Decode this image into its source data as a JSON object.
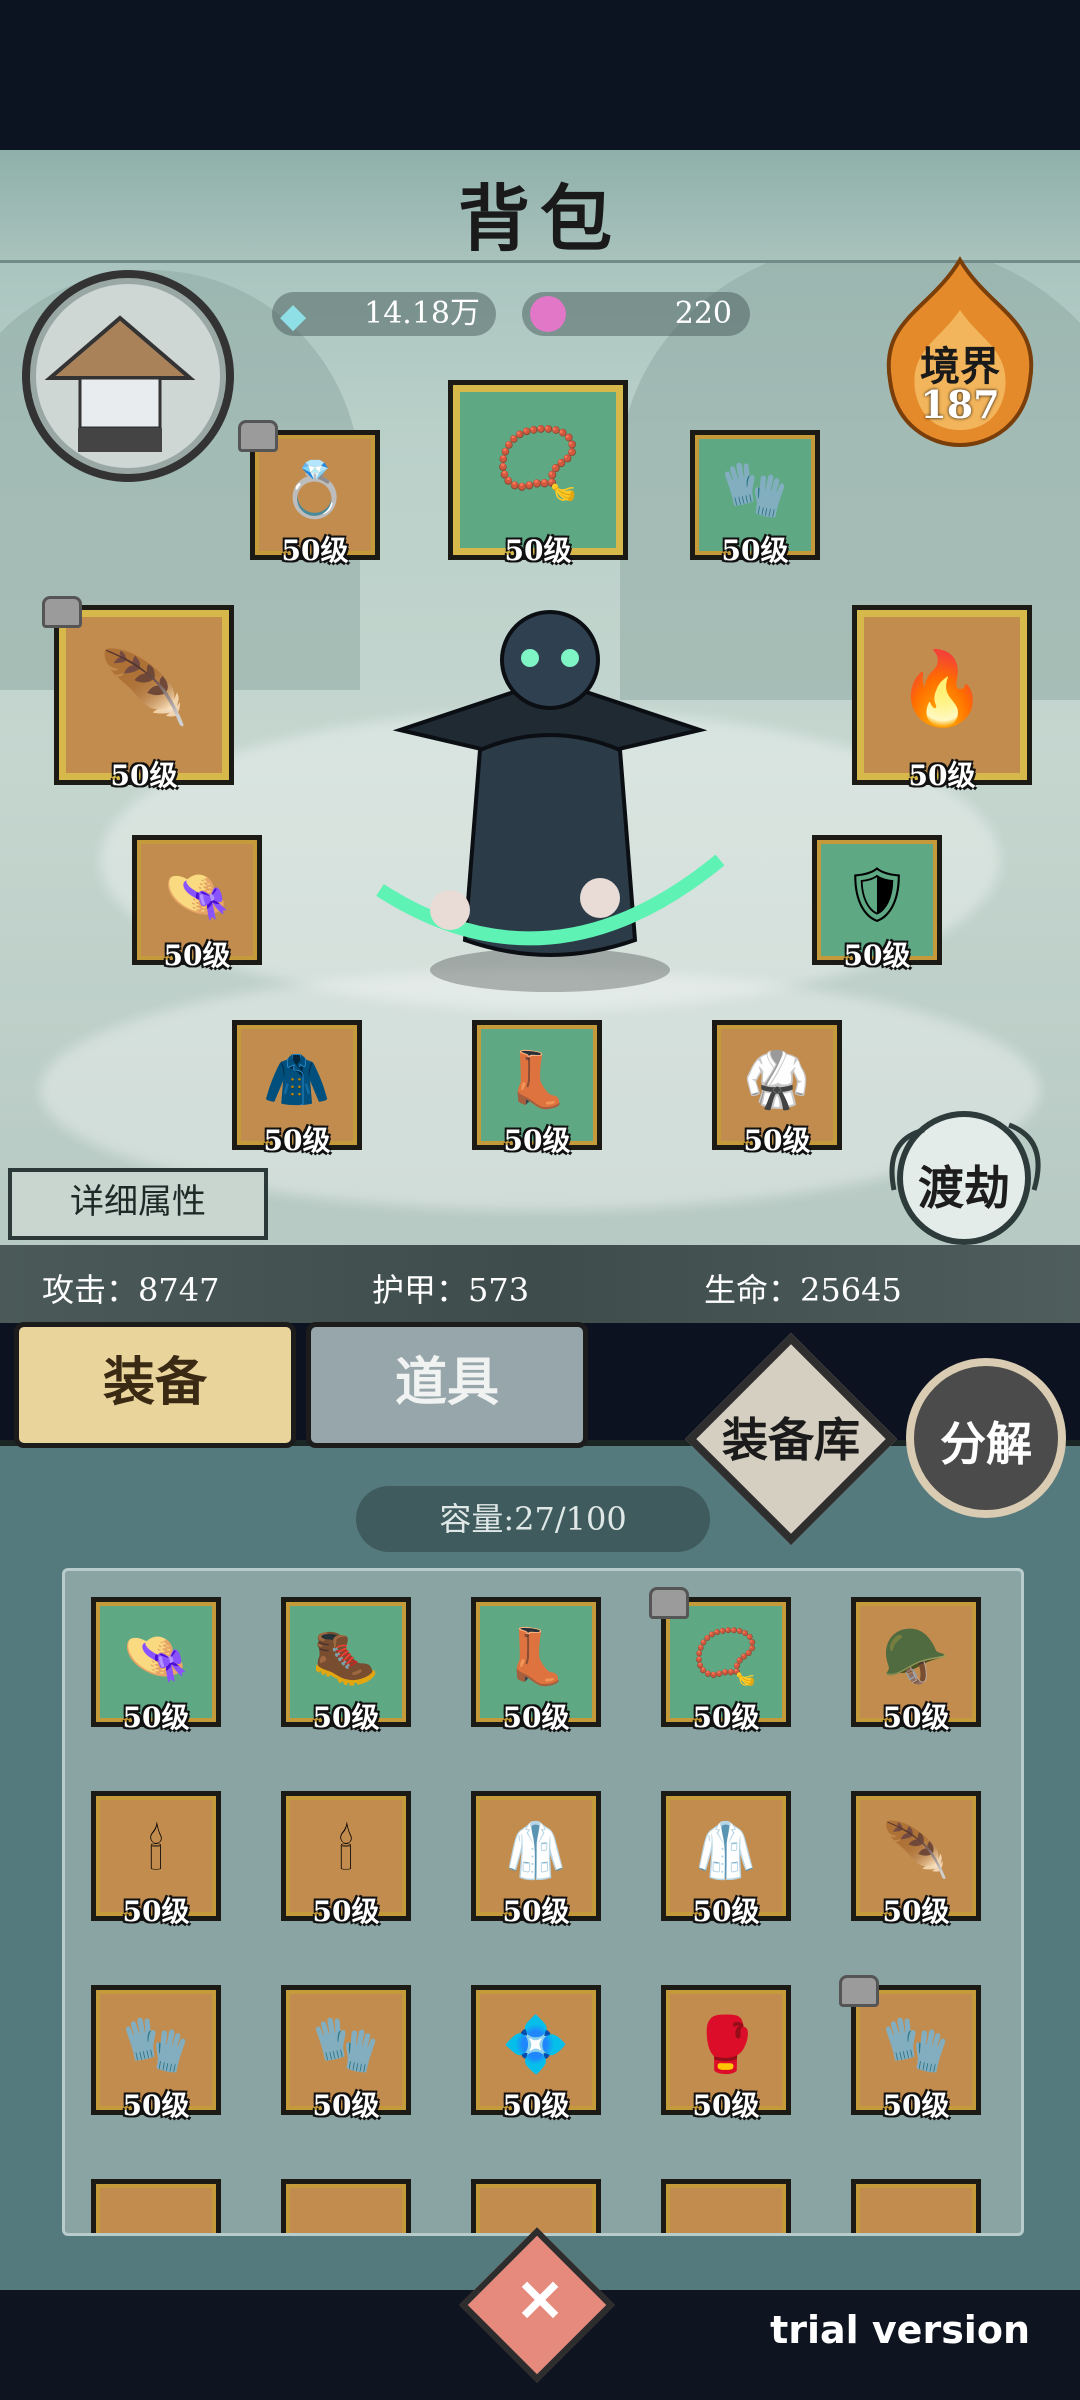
{
  "title": "背包",
  "currency": {
    "jade": "14.18万",
    "pig": "220"
  },
  "realm": {
    "label": "境界",
    "value": "187"
  },
  "equipped_level": "50级",
  "detail_button": "详细属性",
  "dujie_button": "渡劫",
  "stats": {
    "attack": "攻击：8747",
    "armor": "护甲：573",
    "life": "生命：25645"
  },
  "tabs": {
    "equipment": "装备",
    "items": "道具"
  },
  "armory_button": "装备库",
  "decompose_button": "分解",
  "capacity": "容量:27/100",
  "inventory_level": "50级",
  "watermark": "trial version",
  "colors": {
    "orange_slot": "#c28c4f",
    "green_slot": "#5ea884",
    "gold_border": "#c59a3a"
  }
}
